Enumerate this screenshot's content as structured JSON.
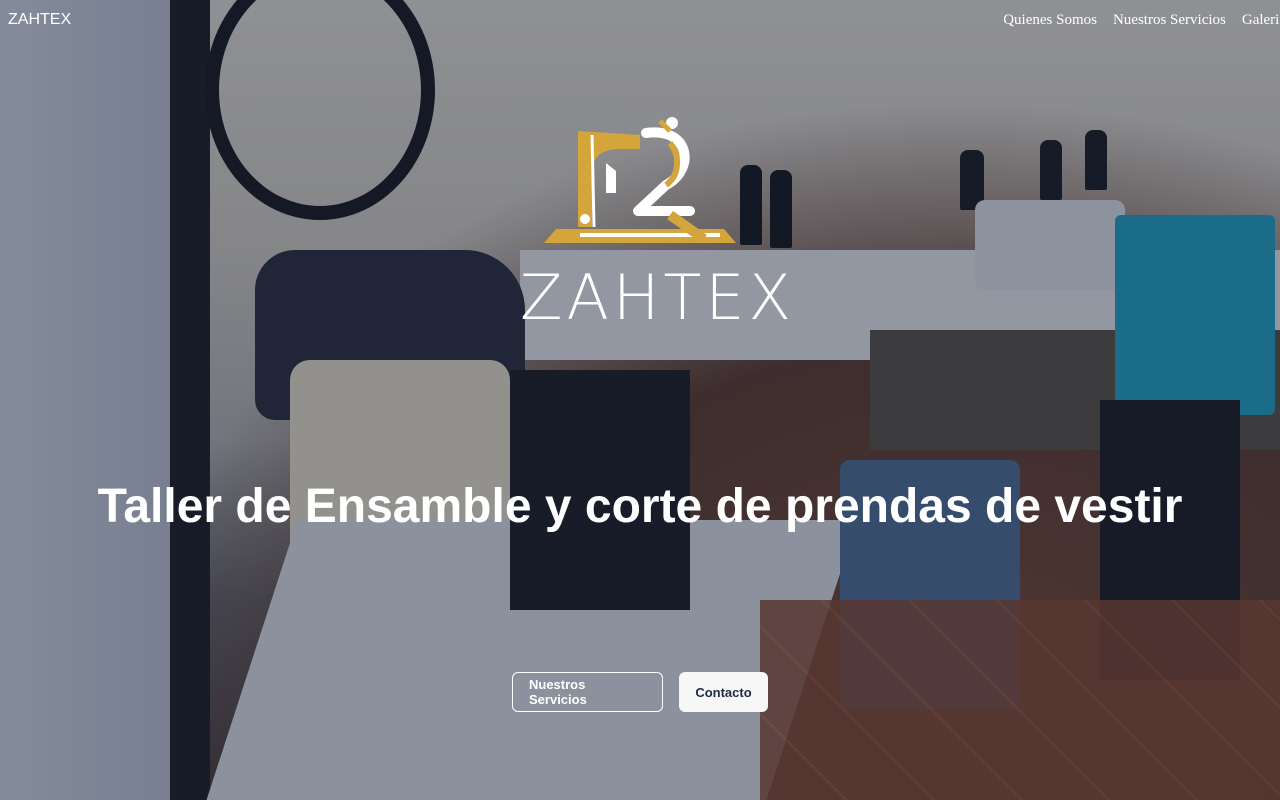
{
  "nav": {
    "brand": "ZAHTEX",
    "links": [
      "Quienes Somos",
      "Nuestros Servicios",
      "Galeria"
    ]
  },
  "hero": {
    "logo_text": "ZAHTEX",
    "headline": "Taller de Ensamble y corte de prendas de vestir",
    "buttons": {
      "primary": "Nuestros Servicios",
      "secondary": "Contacto"
    }
  },
  "colors": {
    "logo_gold": "#d4a53a",
    "overlay": "#141c32",
    "text": "#ffffff"
  },
  "icons": {
    "logo_mark": "sewing-machine-icon"
  }
}
